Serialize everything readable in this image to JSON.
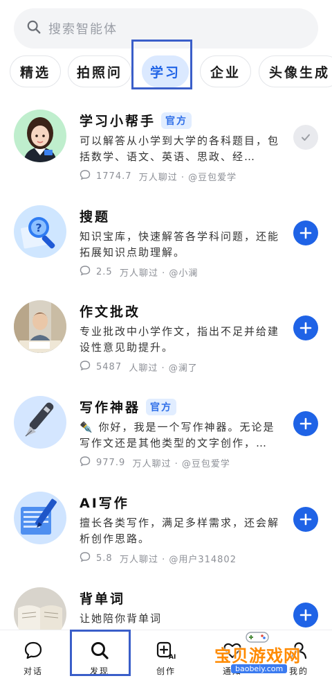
{
  "search": {
    "placeholder": "搜索智能体"
  },
  "tabs": [
    {
      "label": "精选"
    },
    {
      "label": "拍照问"
    },
    {
      "label": "学习",
      "active": true
    },
    {
      "label": "企业"
    },
    {
      "label": "头像生成"
    }
  ],
  "items": [
    {
      "title": "学习小帮手",
      "badge": "官方",
      "desc": "可以解答从小学到大学的各科题目，包括数学、语文、英语、思政、经…",
      "meta_count": "1774.7",
      "meta_suffix": "万人聊过 · @豆包爱学",
      "action": "added",
      "icon": "girl-avatar"
    },
    {
      "title": "搜题",
      "badge": "",
      "desc": "知识宝库，快速解答各学科问题，还能拓展知识点助理解。",
      "meta_count": "2.5",
      "meta_suffix": "万人聊过 · @小澜",
      "action": "add",
      "icon": "magnifier-question-avatar"
    },
    {
      "title": "作文批改",
      "badge": "",
      "desc": "专业批改中小学作文，指出不足并给建设性意见助提升。",
      "meta_count": "5487",
      "meta_suffix": "人聊过 · @澜了",
      "action": "add",
      "icon": "student-writing-avatar"
    },
    {
      "title": "写作神器",
      "badge": "官方",
      "desc": "✒️ 你好，我是一个写作神器。无论是写作文还是其他类型的文字创作，…",
      "meta_count": "977.9",
      "meta_suffix": "万人聊过 · @豆包爱学",
      "action": "add",
      "icon": "fountain-pen-avatar"
    },
    {
      "title": "AI写作",
      "badge": "",
      "desc": "擅长各类写作，满足多样需求，还会解析创作思路。",
      "meta_count": "5.8",
      "meta_suffix": "万人聊过 · @用户314802",
      "action": "add",
      "icon": "document-pen-avatar"
    },
    {
      "title": "背单词",
      "badge": "",
      "desc": "让她陪你背单词",
      "meta_count": "",
      "meta_suffix": "",
      "action": "add",
      "icon": "open-book-avatar"
    }
  ],
  "bottom_nav": [
    {
      "label": "对话",
      "icon": "chat-bubble-icon"
    },
    {
      "label": "发现",
      "icon": "search-icon",
      "active": true
    },
    {
      "label": "创作",
      "icon": "ai-create-icon"
    },
    {
      "label": "通知",
      "icon": "heart-icon"
    },
    {
      "label": "我的",
      "icon": "user-icon"
    }
  ],
  "watermark": {
    "text": "宝贝游戏网",
    "url": "baobeiy.com"
  },
  "colors": {
    "accent": "#1f63e6",
    "tab_active_bg": "#dbe9ff",
    "highlight_box": "#3a5ec9"
  }
}
